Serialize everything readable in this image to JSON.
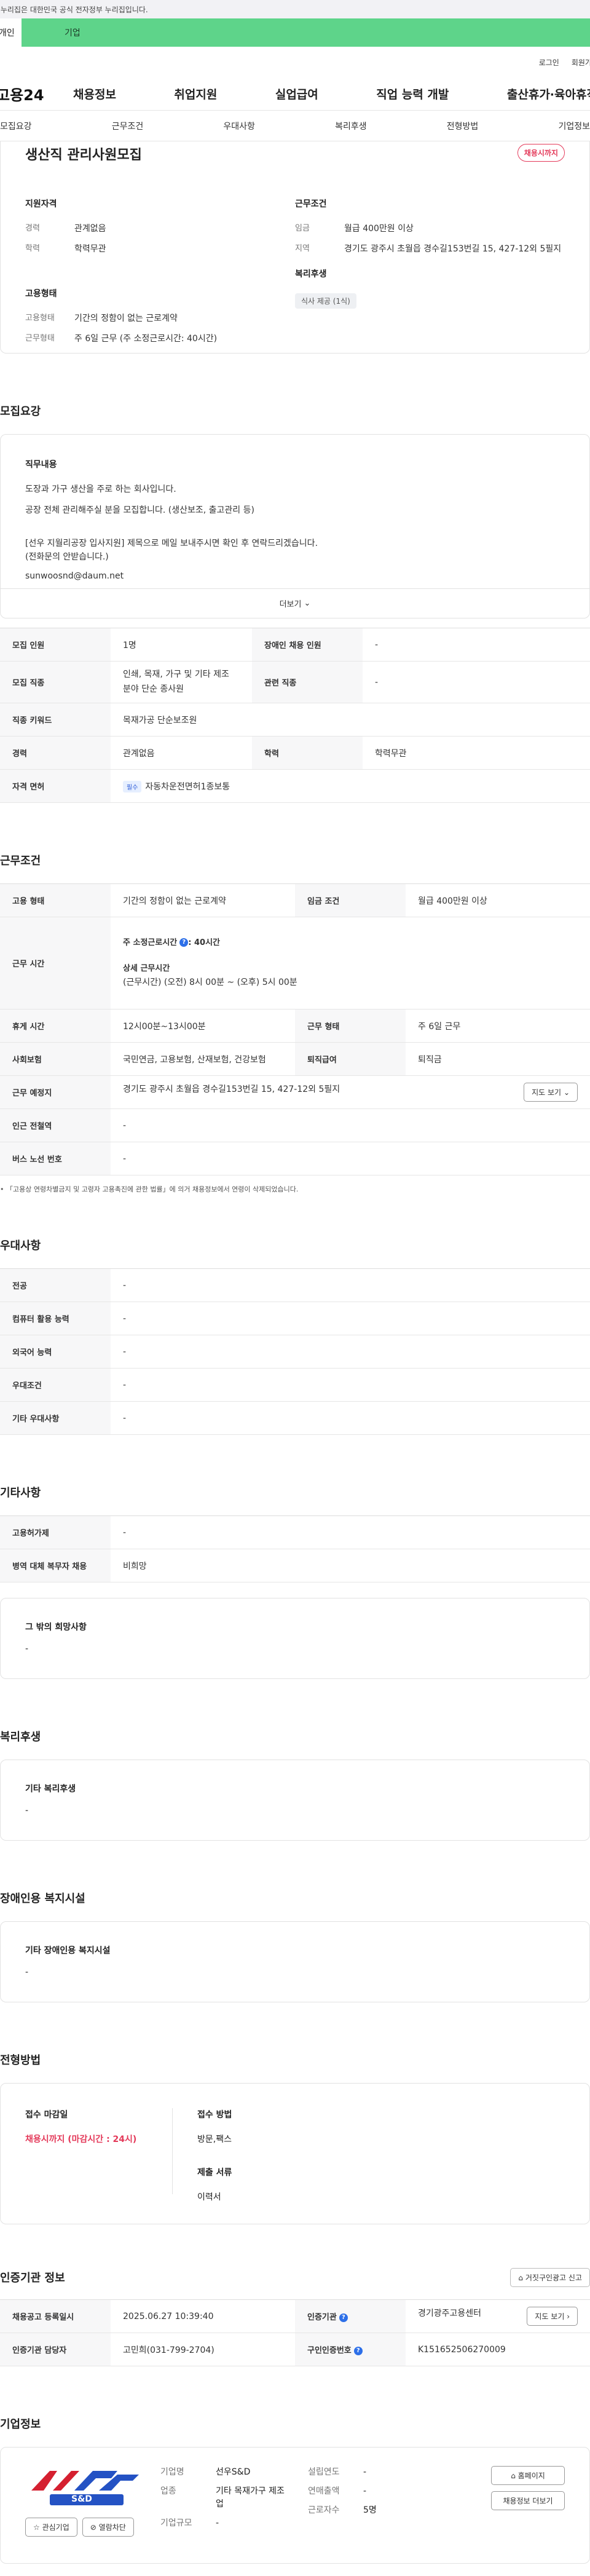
{
  "gov_notice": "이 누리집은 대한민국 공식 전자정부 누리집입니다.",
  "tabs": [
    "개인",
    "기업"
  ],
  "util": [
    "로그인",
    "회원가입"
  ],
  "gnb": {
    "logo": "고용24",
    "items": [
      "채용정보",
      "취업지원",
      "실업급여",
      "직업 능력 개발",
      "출산휴가·육아휴직"
    ]
  },
  "subnav": [
    "모집요강",
    "근무조건",
    "우대사항",
    "복리후생",
    "전형방법",
    "기업정보"
  ],
  "summary": {
    "title": "생산직 관리사원모집",
    "status": "채용시까지",
    "qual_head": "지원자격",
    "qual": [
      {
        "k": "경력",
        "v": "관계없음"
      },
      {
        "k": "학력",
        "v": "학력무관"
      }
    ],
    "cond_head": "근무조건",
    "cond": [
      {
        "k": "임금",
        "v": "월급 400만원 이상"
      },
      {
        "k": "지역",
        "v": "경기도 광주시 초월읍 경수길153번길 15, 427-12외 5필지"
      }
    ],
    "emp_head": "고용형태",
    "emp": [
      {
        "k": "고용형태",
        "v": "기간의 정함이 없는 근로계약"
      },
      {
        "k": "근무형태",
        "v": "주 6일 근무 (주 소정근로시간: 40시간)"
      }
    ],
    "welfare_head": "복리후생",
    "welfare_chip": "식사 제공 (1식)"
  },
  "recruit": {
    "title": "모집요강",
    "job_head": "직무내용",
    "lines": [
      "도장과 가구 생산을 주로 하는 회사입니다.",
      "공장 전체 관리해주실 분을 모집합니다. (생산보조, 출고관리 등)",
      "[선우 지월리공장 입사지원] 제목으로 메일 보내주시면 확인 후 연락드리겠습니다.",
      "(전화문의 안받습니다.)",
      "sunwoosnd@daum.net"
    ],
    "more": "더보기"
  },
  "recruit_table": {
    "r1": [
      "모집 인원",
      "1명",
      "장애인 채용 인원",
      "-"
    ],
    "r2": [
      "모집 직종",
      "인쇄, 목재, 가구 및 기타 제조 분야 단순 종사원",
      "관련 직종",
      "-"
    ],
    "r3": [
      "직종 키워드",
      "목재가공 단순보조원"
    ],
    "r4": [
      "경력",
      "관계없음",
      "학력",
      "학력무관"
    ],
    "r5": [
      "자격 면허",
      "필수",
      "자동차운전면허1종보통"
    ]
  },
  "work": {
    "title": "근무조건",
    "r1": [
      "고용 형태",
      "기간의 정함이 없는 근로계약",
      "임금 조건",
      "월급 400만원 이상"
    ],
    "hours_k": "근무 시간",
    "hours_a": "주 소정근로시간",
    "hours_b": ": 40시간",
    "hours_c": "상세 근무시간",
    "hours_d": "(근무시간) (오전) 8시 00분 ~ (오후) 5시 00분",
    "r3": [
      "휴게 시간",
      "12시00분~13시00분",
      "근무 형태",
      "주 6일 근무"
    ],
    "r4": [
      "사회보험",
      "국민연금, 고용보험, 산재보험, 건강보험",
      "퇴직급여",
      "퇴직금"
    ],
    "r5": [
      "근무 예정지",
      "경기도 광주시 초월읍 경수길153번길 15, 427-12외 5필지",
      "지도 보기"
    ],
    "r6": [
      "인근 전철역",
      "-"
    ],
    "r7": [
      "버스 노선 번호",
      "-"
    ],
    "note": "「고용상 연령차별금지 및 고령자 고용촉진에 관한 법률」에 의거 채용정보에서 연령이 삭제되었습니다."
  },
  "pref": {
    "title": "우대사항",
    "rows": [
      [
        "전공",
        "-"
      ],
      [
        "컴퓨터 활용 능력",
        "-"
      ],
      [
        "외국어 능력",
        "-"
      ],
      [
        "우대조건",
        "-"
      ],
      [
        "기타 우대사항",
        "-"
      ]
    ]
  },
  "etc": {
    "title": "기타사항",
    "rows": [
      [
        "고용허가제",
        "-"
      ],
      [
        "병역 대체 복무자 채용",
        "비희망"
      ]
    ],
    "other_head": "그 밖의 희망사항",
    "other_val": "-"
  },
  "welfare": {
    "title": "복리후생",
    "head": "기타 복리후생",
    "val": "-"
  },
  "disab": {
    "title": "장애인용 복지시설",
    "head": "기타 장애인용 복지시설",
    "val": "-"
  },
  "process": {
    "title": "전형방법",
    "deadline_head": "접수 마감일",
    "deadline_val": "채용시까지 (마감시간 : 24시)",
    "method_head": "접수 방법",
    "method_val": "방문,팩스",
    "docs_head": "제출 서류",
    "docs_val": "이력서"
  },
  "cert": {
    "title": "인증기관 정보",
    "report": "거짓구인광고 신고",
    "r1": [
      "채용공고 등록일시",
      "2025.06.27 10:39:40",
      "인증기관",
      "경기광주고용센터",
      "지도 보기"
    ],
    "r2": [
      "인증기관 담당자",
      "고민희(031-799-2704)",
      "구인인증번호",
      "K151652506270009"
    ]
  },
  "company": {
    "title": "기업정보",
    "logo_text": "S&D",
    "fav": "관심기업",
    "block": "열람차단",
    "name_k": "기업명",
    "name_v": "선우S&D",
    "industry_k": "업종",
    "industry_v": "기타 목재가구 제조업",
    "size_k": "기업규모",
    "size_v": "-",
    "est_k": "설립연도",
    "est_v": "-",
    "sales_k": "연매출액",
    "sales_v": "-",
    "emp_k": "근로자수",
    "emp_v": "5명",
    "home": "홈페이지",
    "more_jobs": "채용정보 더보기"
  },
  "colors": {
    "accent": "#5ed48a",
    "red": "#e43a5a",
    "blue": "#2d5bd8"
  }
}
